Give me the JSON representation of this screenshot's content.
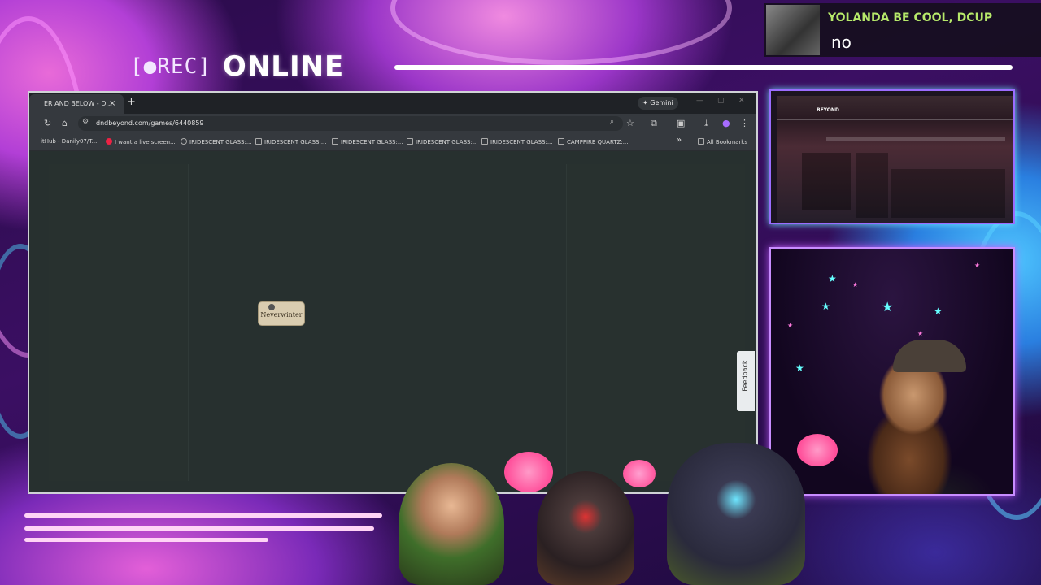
{
  "overlay": {
    "rec_label": "[●REC]",
    "status": "ONLINE"
  },
  "chat": {
    "username": "YOLANDA BE COOL, DCUP",
    "message": "no"
  },
  "browser": {
    "tab_title": "ER AND BELOW - D...",
    "tab_close": "×",
    "new_tab": "+",
    "gemini_label": "✦ Gemini",
    "url": "dndbeyond.com/games/6440859",
    "bookmarks": [
      "itHub - Danily07/T...",
      "I want a live screen...",
      "IRIDESCENT GLASS:...",
      "IRIDESCENT GLASS:...",
      "IRIDESCENT GLASS:...",
      "IRIDESCENT GLASS:...",
      "IRIDESCENT GLASS:...",
      "CAMPFIRE QUARTZ:..."
    ],
    "bookmarks_overflow": "»",
    "all_bookmarks": "All Bookmarks",
    "map_location": "Neverwinter",
    "feedback_label": "Feedback",
    "zoom_plus": "+"
  },
  "cam_top": {
    "brand": "BEYOND"
  },
  "colors": {
    "accent_pink": "#e86ad8",
    "accent_blue": "#4fc7ff",
    "chat_name": "#b6e86a",
    "browser_bg": "#27302f"
  }
}
